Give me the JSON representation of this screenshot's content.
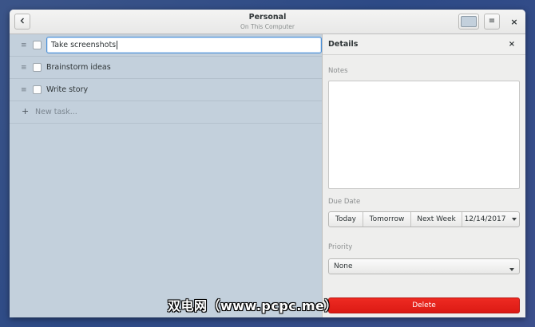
{
  "window": {
    "title": "Personal",
    "subtitle": "On This Computer"
  },
  "icons": {
    "back": "go-back-icon",
    "color": "list-color-icon",
    "menu": "hamburger-menu-icon",
    "close": "close-icon",
    "drag": "drag-handle-icon",
    "add": "plus-icon",
    "dropdown": "chevron-down-icon"
  },
  "glyphs": {
    "menu": "≡",
    "close": "×",
    "drag": "≡",
    "add": "+"
  },
  "colors": {
    "list_color": "#c3d0dc",
    "delete": "#e3201b",
    "focus": "#4a90d9"
  },
  "tasks": [
    {
      "title": "Take screenshots",
      "done": false,
      "editing": true
    },
    {
      "title": "Brainstorm ideas",
      "done": false,
      "editing": false
    },
    {
      "title": "Write story",
      "done": false,
      "editing": false
    }
  ],
  "new_task": {
    "placeholder": "New task..."
  },
  "details": {
    "title": "Details",
    "notes_label": "Notes",
    "notes_value": "",
    "due_date_label": "Due Date",
    "due_buttons": [
      "Today",
      "Tomorrow",
      "Next Week"
    ],
    "due_date_value": "12/14/2017",
    "priority_label": "Priority",
    "priority_value": "None",
    "delete_label": "Delete"
  },
  "watermark": "双电网（www.pcpc.me）"
}
